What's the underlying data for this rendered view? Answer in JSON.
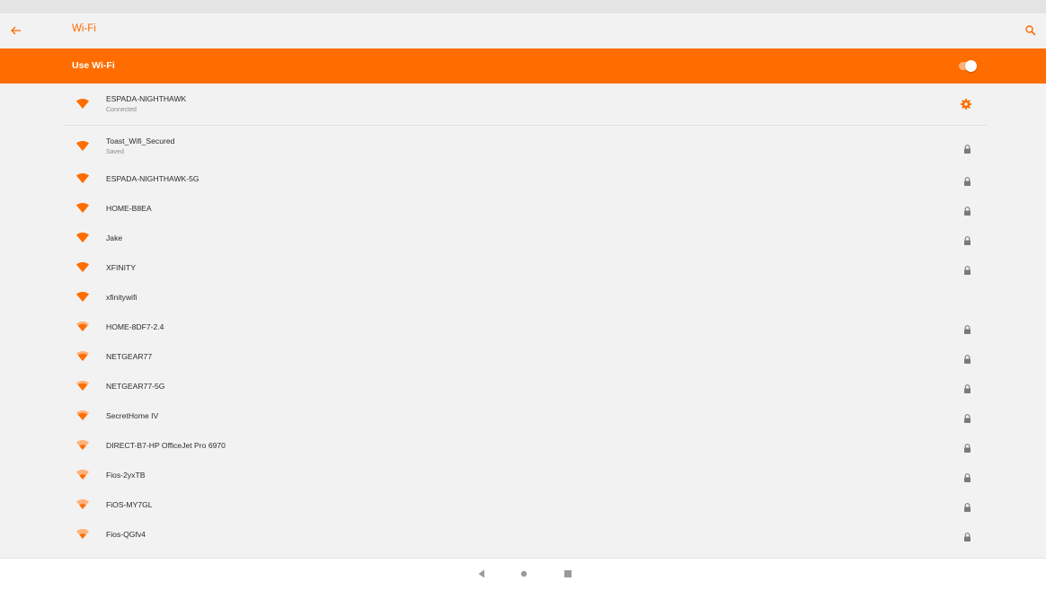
{
  "header": {
    "title": "Wi-Fi",
    "back_icon": "arrow-back-icon",
    "search_icon": "search-icon"
  },
  "wifi_toggle": {
    "label": "Use Wi-Fi",
    "enabled": true
  },
  "colors": {
    "accent": "#ff6d00",
    "weak_signal": "#ffb27a"
  },
  "networks": [
    {
      "name": "ESPADA-NIGHTHAWK",
      "status": "Connected",
      "strength": 4,
      "secured": false,
      "connected": true
    },
    {
      "name": "Toast_Wifi_Secured",
      "status": "Saved",
      "strength": 4,
      "secured": true,
      "connected": false
    },
    {
      "name": "ESPADA-NIGHTHAWK-5G",
      "status": "",
      "strength": 4,
      "secured": true,
      "connected": false
    },
    {
      "name": "HOME-B8EA",
      "status": "",
      "strength": 4,
      "secured": true,
      "connected": false
    },
    {
      "name": "Jake",
      "status": "",
      "strength": 4,
      "secured": true,
      "connected": false
    },
    {
      "name": "XFINITY",
      "status": "",
      "strength": 4,
      "secured": true,
      "connected": false
    },
    {
      "name": "xfinitywifi",
      "status": "",
      "strength": 4,
      "secured": false,
      "connected": false
    },
    {
      "name": "HOME-8DF7-2.4",
      "status": "",
      "strength": 3,
      "secured": true,
      "connected": false
    },
    {
      "name": "NETGEAR77",
      "status": "",
      "strength": 3,
      "secured": true,
      "connected": false
    },
    {
      "name": "NETGEAR77-5G",
      "status": "",
      "strength": 3,
      "secured": true,
      "connected": false
    },
    {
      "name": "SecretHome IV",
      "status": "",
      "strength": 3,
      "secured": true,
      "connected": false
    },
    {
      "name": "DIRECT-B7-HP OfficeJet Pro 6970",
      "status": "",
      "strength": 2,
      "secured": true,
      "connected": false
    },
    {
      "name": "Fios-2yxTB",
      "status": "",
      "strength": 2,
      "secured": true,
      "connected": false
    },
    {
      "name": "FiOS-MY7GL",
      "status": "",
      "strength": 2,
      "secured": true,
      "connected": false
    },
    {
      "name": "Fios-QGfv4",
      "status": "",
      "strength": 2,
      "secured": true,
      "connected": false
    }
  ],
  "navbar": {
    "back": "nav-back-icon",
    "home": "nav-home-icon",
    "recents": "nav-recents-icon"
  }
}
